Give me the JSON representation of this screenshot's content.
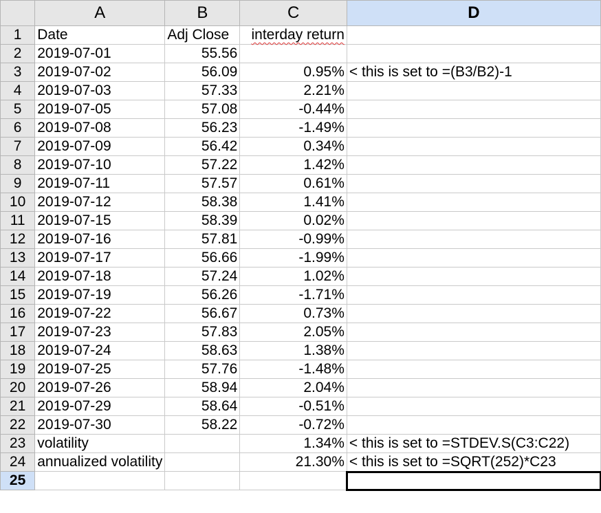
{
  "columns": [
    "A",
    "B",
    "C",
    "D"
  ],
  "rows": [
    {
      "num": "1",
      "a": "Date",
      "b": "Adj Close",
      "c": "interday return",
      "d": ""
    },
    {
      "num": "2",
      "a": "2019-07-01",
      "b": "55.56",
      "c": "",
      "d": ""
    },
    {
      "num": "3",
      "a": "2019-07-02",
      "b": "56.09",
      "c": "0.95%",
      "d": "< this is set to =(B3/B2)-1"
    },
    {
      "num": "4",
      "a": "2019-07-03",
      "b": "57.33",
      "c": "2.21%",
      "d": ""
    },
    {
      "num": "5",
      "a": "2019-07-05",
      "b": "57.08",
      "c": "-0.44%",
      "d": ""
    },
    {
      "num": "6",
      "a": "2019-07-08",
      "b": "56.23",
      "c": "-1.49%",
      "d": ""
    },
    {
      "num": "7",
      "a": "2019-07-09",
      "b": "56.42",
      "c": "0.34%",
      "d": ""
    },
    {
      "num": "8",
      "a": "2019-07-10",
      "b": "57.22",
      "c": "1.42%",
      "d": ""
    },
    {
      "num": "9",
      "a": "2019-07-11",
      "b": "57.57",
      "c": "0.61%",
      "d": ""
    },
    {
      "num": "10",
      "a": "2019-07-12",
      "b": "58.38",
      "c": "1.41%",
      "d": ""
    },
    {
      "num": "11",
      "a": "2019-07-15",
      "b": "58.39",
      "c": "0.02%",
      "d": ""
    },
    {
      "num": "12",
      "a": "2019-07-16",
      "b": "57.81",
      "c": "-0.99%",
      "d": ""
    },
    {
      "num": "13",
      "a": "2019-07-17",
      "b": "56.66",
      "c": "-1.99%",
      "d": ""
    },
    {
      "num": "14",
      "a": "2019-07-18",
      "b": "57.24",
      "c": "1.02%",
      "d": ""
    },
    {
      "num": "15",
      "a": "2019-07-19",
      "b": "56.26",
      "c": "-1.71%",
      "d": ""
    },
    {
      "num": "16",
      "a": "2019-07-22",
      "b": "56.67",
      "c": "0.73%",
      "d": ""
    },
    {
      "num": "17",
      "a": "2019-07-23",
      "b": "57.83",
      "c": "2.05%",
      "d": ""
    },
    {
      "num": "18",
      "a": "2019-07-24",
      "b": "58.63",
      "c": "1.38%",
      "d": ""
    },
    {
      "num": "19",
      "a": "2019-07-25",
      "b": "57.76",
      "c": "-1.48%",
      "d": ""
    },
    {
      "num": "20",
      "a": "2019-07-26",
      "b": "58.94",
      "c": "2.04%",
      "d": ""
    },
    {
      "num": "21",
      "a": "2019-07-29",
      "b": "58.64",
      "c": "-0.51%",
      "d": ""
    },
    {
      "num": "22",
      "a": "2019-07-30",
      "b": "58.22",
      "c": "-0.72%",
      "d": ""
    },
    {
      "num": "23",
      "a": "volatility",
      "b": "",
      "c": "1.34%",
      "d": "< this is set to =STDEV.S(C3:C22)"
    },
    {
      "num": "24",
      "a": "annualized volatility",
      "b": "",
      "c": "21.30%",
      "d": "< this is set to =SQRT(252)*C23"
    },
    {
      "num": "25",
      "a": "",
      "b": "",
      "c": "",
      "d": ""
    }
  ],
  "active_cell": "D25",
  "colors": {
    "header_bg": "#e6e6e6",
    "active_header_bg": "#cfe0f7",
    "grid": "#c9c9c9",
    "spellcheck": "#d33"
  }
}
